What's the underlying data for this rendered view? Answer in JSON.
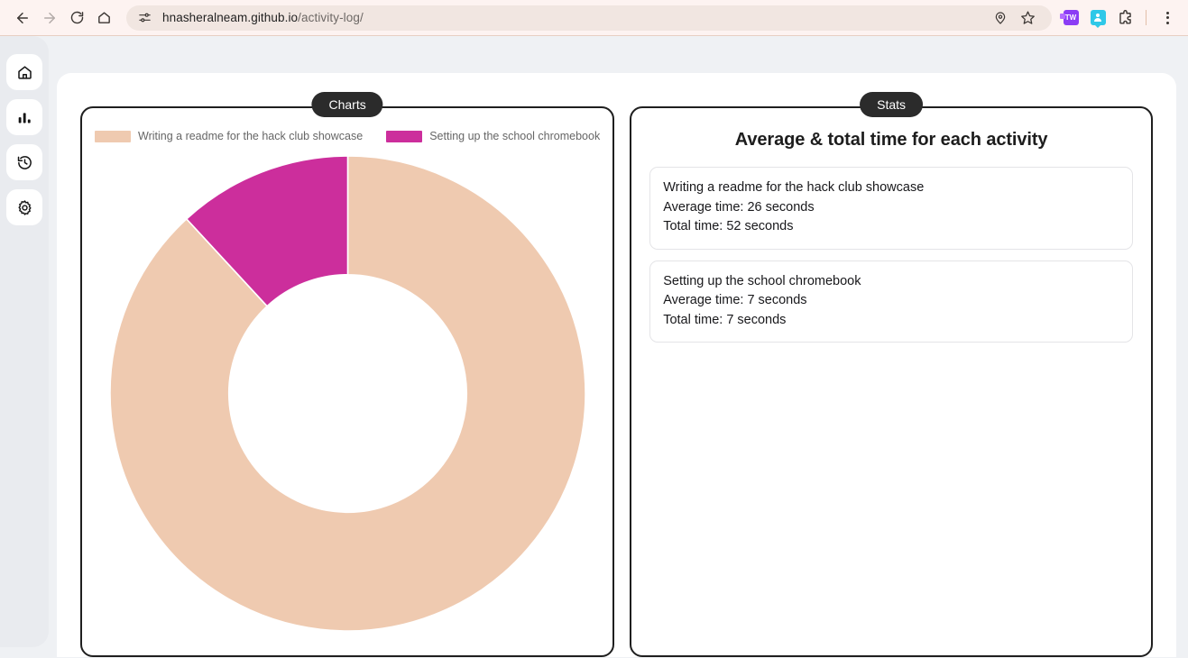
{
  "browser": {
    "back_label": "back-arrow",
    "forward_label": "forward-arrow",
    "reload_label": "reload",
    "home_label": "home",
    "url_host": "hnasheralneam.github.io",
    "url_path": "/activity-log/",
    "site_info_icon": "tune-icon",
    "location_icon": "location-pin-icon",
    "bookmark_icon": "star-icon",
    "ext_tailwind_label": "TW",
    "ext_profile_icon": "person-badge-icon",
    "ext_puzzle_icon": "extensions-puzzle-icon",
    "menu_icon": "three-dot-menu-icon"
  },
  "sidebar": {
    "items": [
      {
        "name": "home",
        "icon": "home-icon"
      },
      {
        "name": "charts",
        "icon": "bar-chart-icon"
      },
      {
        "name": "history",
        "icon": "history-clock-icon"
      },
      {
        "name": "settings",
        "icon": "gear-icon"
      }
    ]
  },
  "charts_card": {
    "badge": "Charts"
  },
  "stats_card": {
    "badge": "Stats",
    "title": "Average & total time for each activity",
    "items": [
      {
        "activity": "Writing a readme for the hack club showcase",
        "average": "Average time: 26 seconds",
        "total": "Total time: 52 seconds"
      },
      {
        "activity": "Setting up the school chromebook",
        "average": "Average time: 7 seconds",
        "total": "Total time: 7 seconds"
      }
    ]
  },
  "chart_data": {
    "type": "pie",
    "variant": "donut",
    "title": "",
    "labels": [
      "Writing a readme for the hack club showcase",
      "Setting up the school chromebook"
    ],
    "values": [
      52,
      7
    ],
    "unit": "seconds",
    "percentages": [
      88.1,
      11.9
    ],
    "colors": [
      "#efcab0",
      "#cc2e9c"
    ],
    "legend_position": "top",
    "start_angle_deg": 0,
    "direction": "counterclockwise",
    "inner_radius_ratio": 0.5,
    "grid": false
  },
  "theme": {
    "accent_peach": "#efcab0",
    "accent_pink": "#cc2e9c",
    "badge_bg": "#2b2b2b",
    "card_border": "#1f1f1f",
    "page_bg": "#eff1f4",
    "chrome_bg": "#fdf3f1"
  }
}
